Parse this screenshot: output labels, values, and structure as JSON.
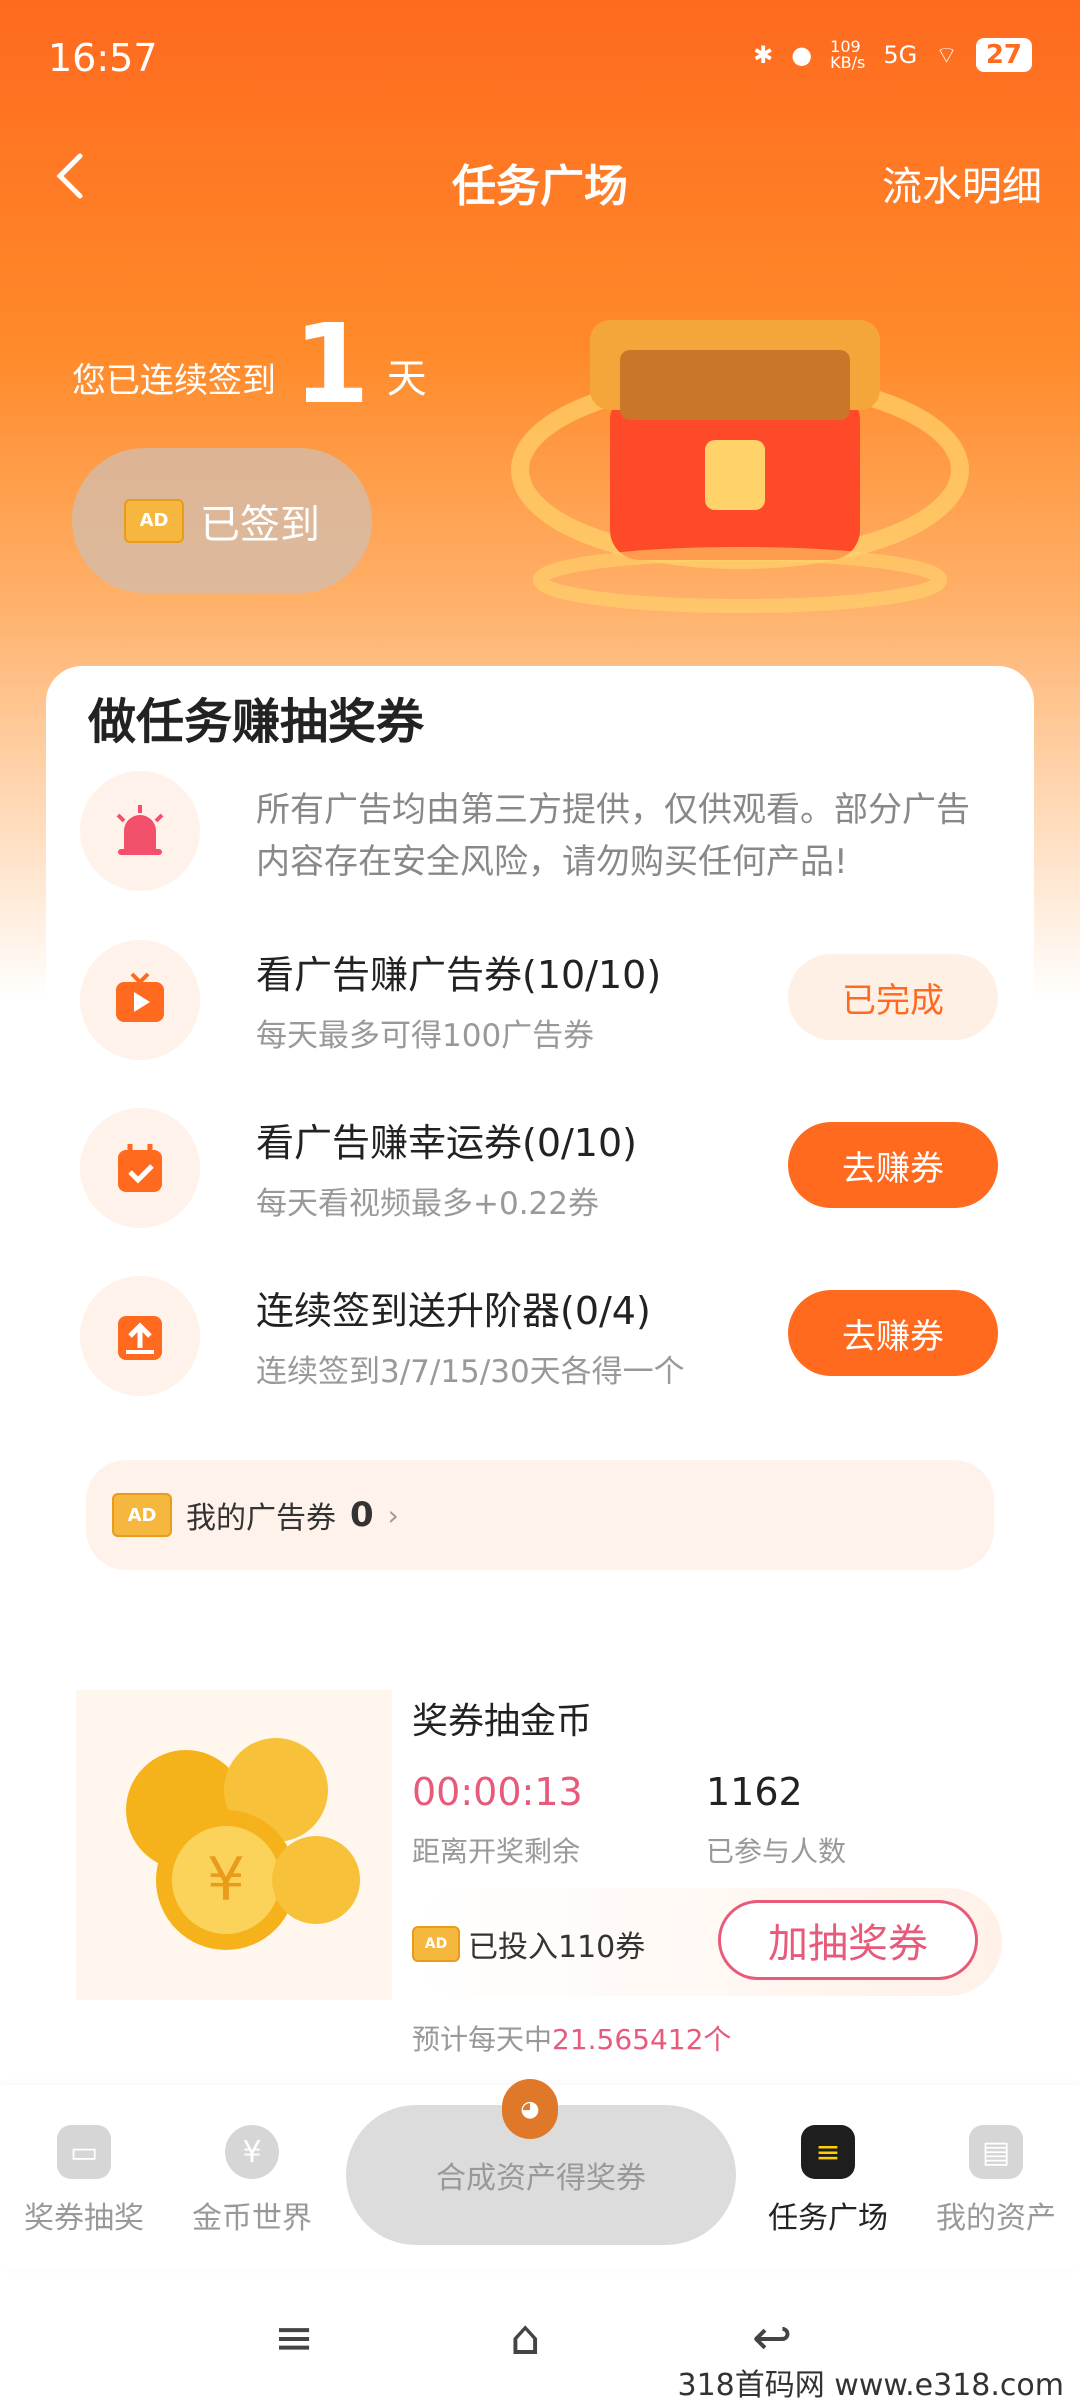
{
  "status_bar": {
    "time": "16:57",
    "speed": "109\nKB/s",
    "network": "5G",
    "battery": "27"
  },
  "header": {
    "back_icon": "chevron-left-icon",
    "title": "任务广场",
    "detail_link": "流水明细"
  },
  "signin": {
    "prefix": "您已连续签到",
    "days": "1",
    "suffix": "天",
    "button_label": "已签到",
    "ticket_text": "AD"
  },
  "tasks_card": {
    "title": "做任务赚抽奖券",
    "notice": "所有广告均由第三方提供，仅供观看。部分广告内容存在安全风险，请勿购买任何产品!",
    "items": [
      {
        "title": "看广告赚广告券(10/10)",
        "subtitle": "每天最多可得100广告券",
        "button": "已完成",
        "icon": "tv-play-icon"
      },
      {
        "title": "看广告赚幸运券(0/10)",
        "subtitle": "每天看视频最多+0.22券",
        "button": "去赚券",
        "icon": "calendar-check-icon"
      },
      {
        "title": "连续签到送升阶器(0/4)",
        "subtitle": "连续签到3/7/15/30天各得一个",
        "button": "去赚券",
        "icon": "upload-box-icon"
      }
    ],
    "my_ads": {
      "label": "我的广告券",
      "count": "0"
    }
  },
  "lottery": {
    "title": "奖券抽金币",
    "countdown": "00:00:13",
    "countdown_label": "距离开奖剩余",
    "participants": "1162",
    "participants_label": "已参与人数",
    "invested": "已投入110券",
    "add_button": "加抽奖券",
    "estimate_prefix": "预计每天中",
    "estimate_value": "21.565412个"
  },
  "tabbar": {
    "tabs": [
      {
        "label": "奖券抽奖",
        "icon": "gift-icon"
      },
      {
        "label": "金币世界",
        "icon": "yen-coin-icon"
      },
      {
        "label": "任务广场",
        "icon": "task-clipboard-icon"
      },
      {
        "label": "我的资产",
        "icon": "wallet-icon"
      }
    ],
    "center": "合成资产得奖券"
  },
  "watermark": "318首码网  www.e318.com",
  "colors": {
    "brand": "#ff6a1f",
    "accent_pink": "#e85a7a"
  }
}
